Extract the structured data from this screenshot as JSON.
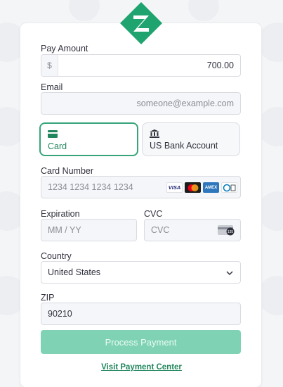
{
  "colors": {
    "accent": "#36a57a",
    "accent_text": "#21865e",
    "button_disabled": "#7fd3b4",
    "logo": "#1fa36f"
  },
  "form": {
    "pay_amount": {
      "label": "Pay Amount",
      "currency_symbol": "$",
      "value": "700.00"
    },
    "email": {
      "label": "Email",
      "placeholder": "someone@example.com"
    },
    "payment_methods": [
      {
        "label": "Card",
        "icon": "credit-card-icon",
        "selected": true
      },
      {
        "label": "US Bank Account",
        "icon": "bank-icon",
        "selected": false
      }
    ],
    "card_number": {
      "label": "Card Number",
      "placeholder": "1234 1234 1234 1234",
      "brands": [
        "VISA",
        "mastercard",
        "AMEX",
        "diners"
      ]
    },
    "expiration": {
      "label": "Expiration",
      "placeholder": "MM / YY"
    },
    "cvc": {
      "label": "CVC",
      "placeholder": "CVC",
      "icon_text": "135"
    },
    "country": {
      "label": "Country",
      "value": "United States"
    },
    "zip": {
      "label": "ZIP",
      "value": "90210"
    }
  },
  "actions": {
    "process_label": "Process Payment",
    "visit_link": "Visit Payment Center"
  }
}
